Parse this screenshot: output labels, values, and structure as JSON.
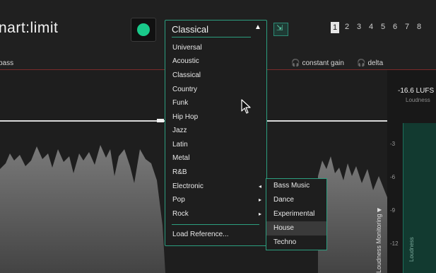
{
  "app": {
    "title": "nart:limit"
  },
  "slots": [
    "1",
    "2",
    "3",
    "4",
    "5",
    "6",
    "7",
    "8"
  ],
  "strip": {
    "label": "bass",
    "constant_gain": "constant gain",
    "delta": "delta"
  },
  "loudness": {
    "value": "-16.6 LUFS",
    "caption": "Loudness",
    "ticks": [
      "-3",
      "-6",
      "-9",
      "-12"
    ],
    "monitor_label": "Loudness Monitoring",
    "meter_label": "Loudness"
  },
  "profile_dropdown": {
    "selected": "Classical",
    "items": [
      {
        "label": "Universal"
      },
      {
        "label": "Acoustic"
      },
      {
        "label": "Classical"
      },
      {
        "label": "Country"
      },
      {
        "label": "Funk"
      },
      {
        "label": "Hip Hop"
      },
      {
        "label": "Jazz"
      },
      {
        "label": "Latin"
      },
      {
        "label": "Metal"
      },
      {
        "label": "R&B"
      },
      {
        "label": "Electronic",
        "arrow": "◂"
      },
      {
        "label": "Pop",
        "arrow": "▸"
      },
      {
        "label": "Rock",
        "arrow": "▸"
      }
    ],
    "load_reference": "Load Reference..."
  },
  "electronic_submenu": {
    "items": [
      "Bass Music",
      "Dance",
      "Experimental",
      "House",
      "Techno"
    ],
    "hovered": "House"
  },
  "colors": {
    "accent": "#2c9e7f",
    "led": "#19c98a"
  }
}
